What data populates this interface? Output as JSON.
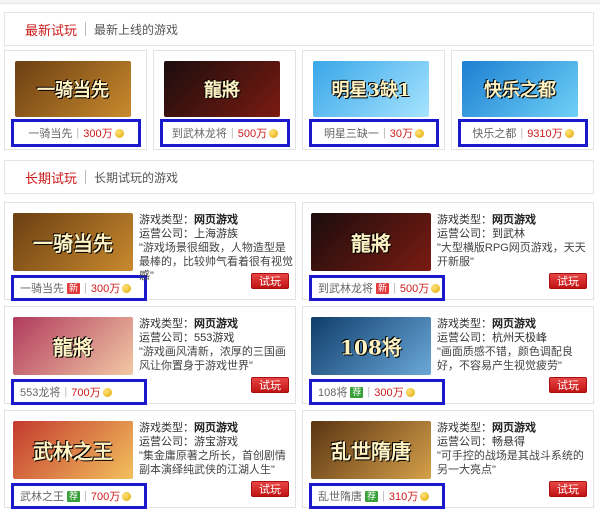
{
  "sections": {
    "new": {
      "title": "最新试玩",
      "subtitle": "最新上线的游戏"
    },
    "long": {
      "title": "长期试玩",
      "subtitle": "长期试玩的游戏"
    }
  },
  "labels": {
    "type_label": "游戏类型：",
    "company_label": "运营公司：",
    "try_button": "试玩",
    "tag_new": "新",
    "tag_rec": "荐",
    "coin_icon": "gold-coin-icon"
  },
  "new_games": [
    {
      "name": "一骑当先",
      "count": "300万",
      "art": "一骑当先",
      "colors": [
        "#6b3f12",
        "#c98a2e"
      ]
    },
    {
      "name": "到武林龙将",
      "count": "500万",
      "art": "龍將",
      "colors": [
        "#1b0d0d",
        "#7a1b12"
      ]
    },
    {
      "name": "明星三缺一",
      "count": "30万",
      "art": "明星3缺1",
      "colors": [
        "#39a7e8",
        "#a7e3ff"
      ]
    },
    {
      "name": "快乐之都",
      "count": "9310万",
      "art": "快乐之都",
      "colors": [
        "#1d7fd1",
        "#6fd0f7"
      ]
    }
  ],
  "long_games": [
    {
      "name": "一骑当先",
      "tag": "new",
      "count": "300万",
      "art": "一骑当先",
      "colors": [
        "#6b3f12",
        "#c98a2e"
      ],
      "type": "网页游戏",
      "company": "上海游族",
      "desc": "\"游戏场景很细致，人物造型是最棒的，比较帅气看着很有视觉感\""
    },
    {
      "name": "到武林龙将",
      "tag": "new",
      "count": "500万",
      "art": "龍將",
      "colors": [
        "#1b0d0d",
        "#7a1b12"
      ],
      "type": "网页游戏",
      "company": "到武林",
      "desc": "\"大型横版RPG网页游戏，天天开新服\""
    },
    {
      "name": "553龙将",
      "tag": "",
      "count": "700万",
      "art": "龍將",
      "colors": [
        "#b13a5d",
        "#f2c9a5"
      ],
      "type": "网页游戏",
      "company": "553游戏",
      "desc": "\"游戏画风清新，浓厚的三国画风让你置身于游戏世界\""
    },
    {
      "name": "108将",
      "tag": "rec",
      "count": "300万",
      "art": "108将",
      "colors": [
        "#0f3d6b",
        "#6aa8d8"
      ],
      "type": "网页游戏",
      "company": "杭州天极峰",
      "desc": "\"画面质感不错，颜色调配良好，不容易产生视觉疲劳\""
    },
    {
      "name": "武林之王",
      "tag": "rec",
      "count": "700万",
      "art": "武林之王",
      "colors": [
        "#c43a2f",
        "#f2c05d"
      ],
      "type": "网页游戏",
      "company": "游宝游戏",
      "desc": "\"集金庸原著之所长，首创剧情副本演绎纯武侠的江湖人生\""
    },
    {
      "name": "乱世隋唐",
      "tag": "rec",
      "count": "310万",
      "art": "乱世隋唐",
      "colors": [
        "#5a3412",
        "#d5a04a"
      ],
      "type": "网页游戏",
      "company": "畅悬得",
      "desc": "\"可手控的战场是其战斗系统的另一大亮点\""
    }
  ]
}
